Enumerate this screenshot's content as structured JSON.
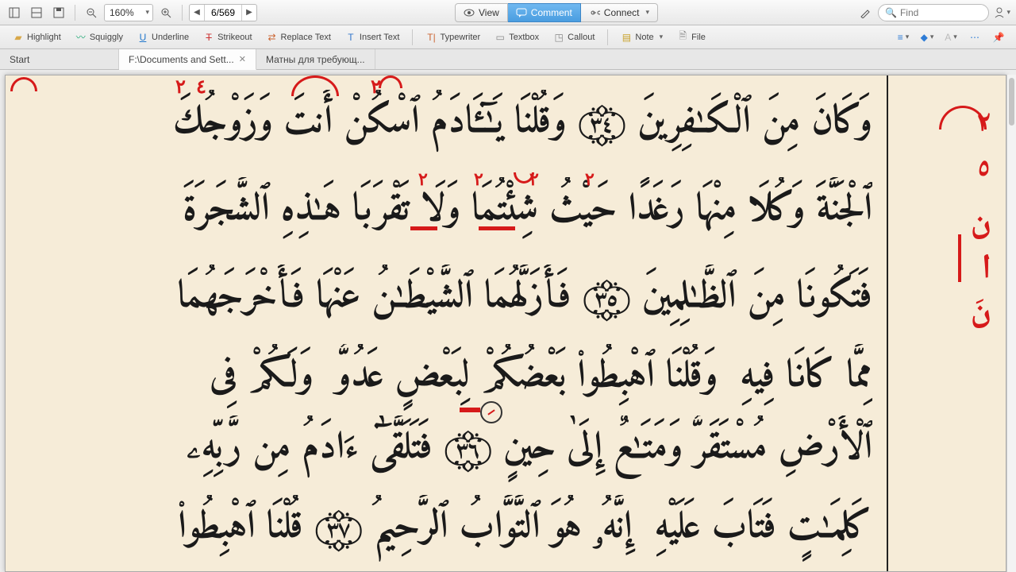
{
  "toolbar": {
    "zoom": "160%",
    "page": "6/569",
    "view_label": "View",
    "comment_label": "Comment",
    "connect_label": "Connect",
    "search_placeholder": "Find"
  },
  "tools": {
    "highlight": "Highlight",
    "squiggly": "Squiggly",
    "underline": "Underline",
    "strikeout": "Strikeout",
    "replace": "Replace Text",
    "insert": "Insert Text",
    "typewriter": "Typewriter",
    "textbox": "Textbox",
    "callout": "Callout",
    "note": "Note",
    "file": "File"
  },
  "tabs": {
    "t0": "Start",
    "t1": "F:\\Documents and Sett...",
    "t2": "Матны для требующ..."
  },
  "arabic_lines": {
    "l1": "وَكَانَ مِنَ ٱلْكَـٰفِرِينَ ۝٣٤ وَقُلْنَا يَـٰٓـَٔادَمُ ٱسْكُنْ أَنتَ وَزَوْجُكَ",
    "l2": "ٱلْجَنَّةَ وَكُلَا مِنْهَا رَغَدًا حَيْثُ شِئْتُمَا وَلَا تَقْرَبَا هَـٰذِهِ ٱلشَّجَرَةَ",
    "l3": "فَتَكُونَا مِنَ ٱلظَّـٰلِمِينَ ۝٣٥ فَأَزَلَّهُمَا ٱلشَّيْطَـٰنُ عَنْهَا فَأَخْرَجَهُمَا",
    "l4": "مِمَّا كَانَا فِيهِ ۖ وَقُلْنَا ٱهْبِطُوا۟ بَعْضُكُمْ لِبَعْضٍ عَدُوٌّ ۖ وَلَكُمْ فِى",
    "l5": "ٱلْأَرْضِ مُسْتَقَرٌّ وَمَتَـٰعٌ إِلَىٰ حِينٍ ۝٣٦ فَتَلَقَّىٰٓ ءَادَمُ مِن رَّبِّهِۦ",
    "l6": "كَلِمَـٰتٍ فَتَابَ عَلَيْهِ ۚ إِنَّهُۥ هُوَ ٱلتَّوَّابُ ٱلرَّحِيمُ ۝٣٧ قُلْنَا ٱهْبِطُوا۟"
  },
  "margin": {
    "n1": "٢",
    "n2": "٥",
    "n3": "ن",
    "n4": "ا",
    "n5": "نَ"
  },
  "annot": {
    "a1": "٢",
    "a2": "٤",
    "a3": "٢",
    "b1": "٢",
    "b2": "٢",
    "b3": "٢",
    "b4": "٢"
  }
}
